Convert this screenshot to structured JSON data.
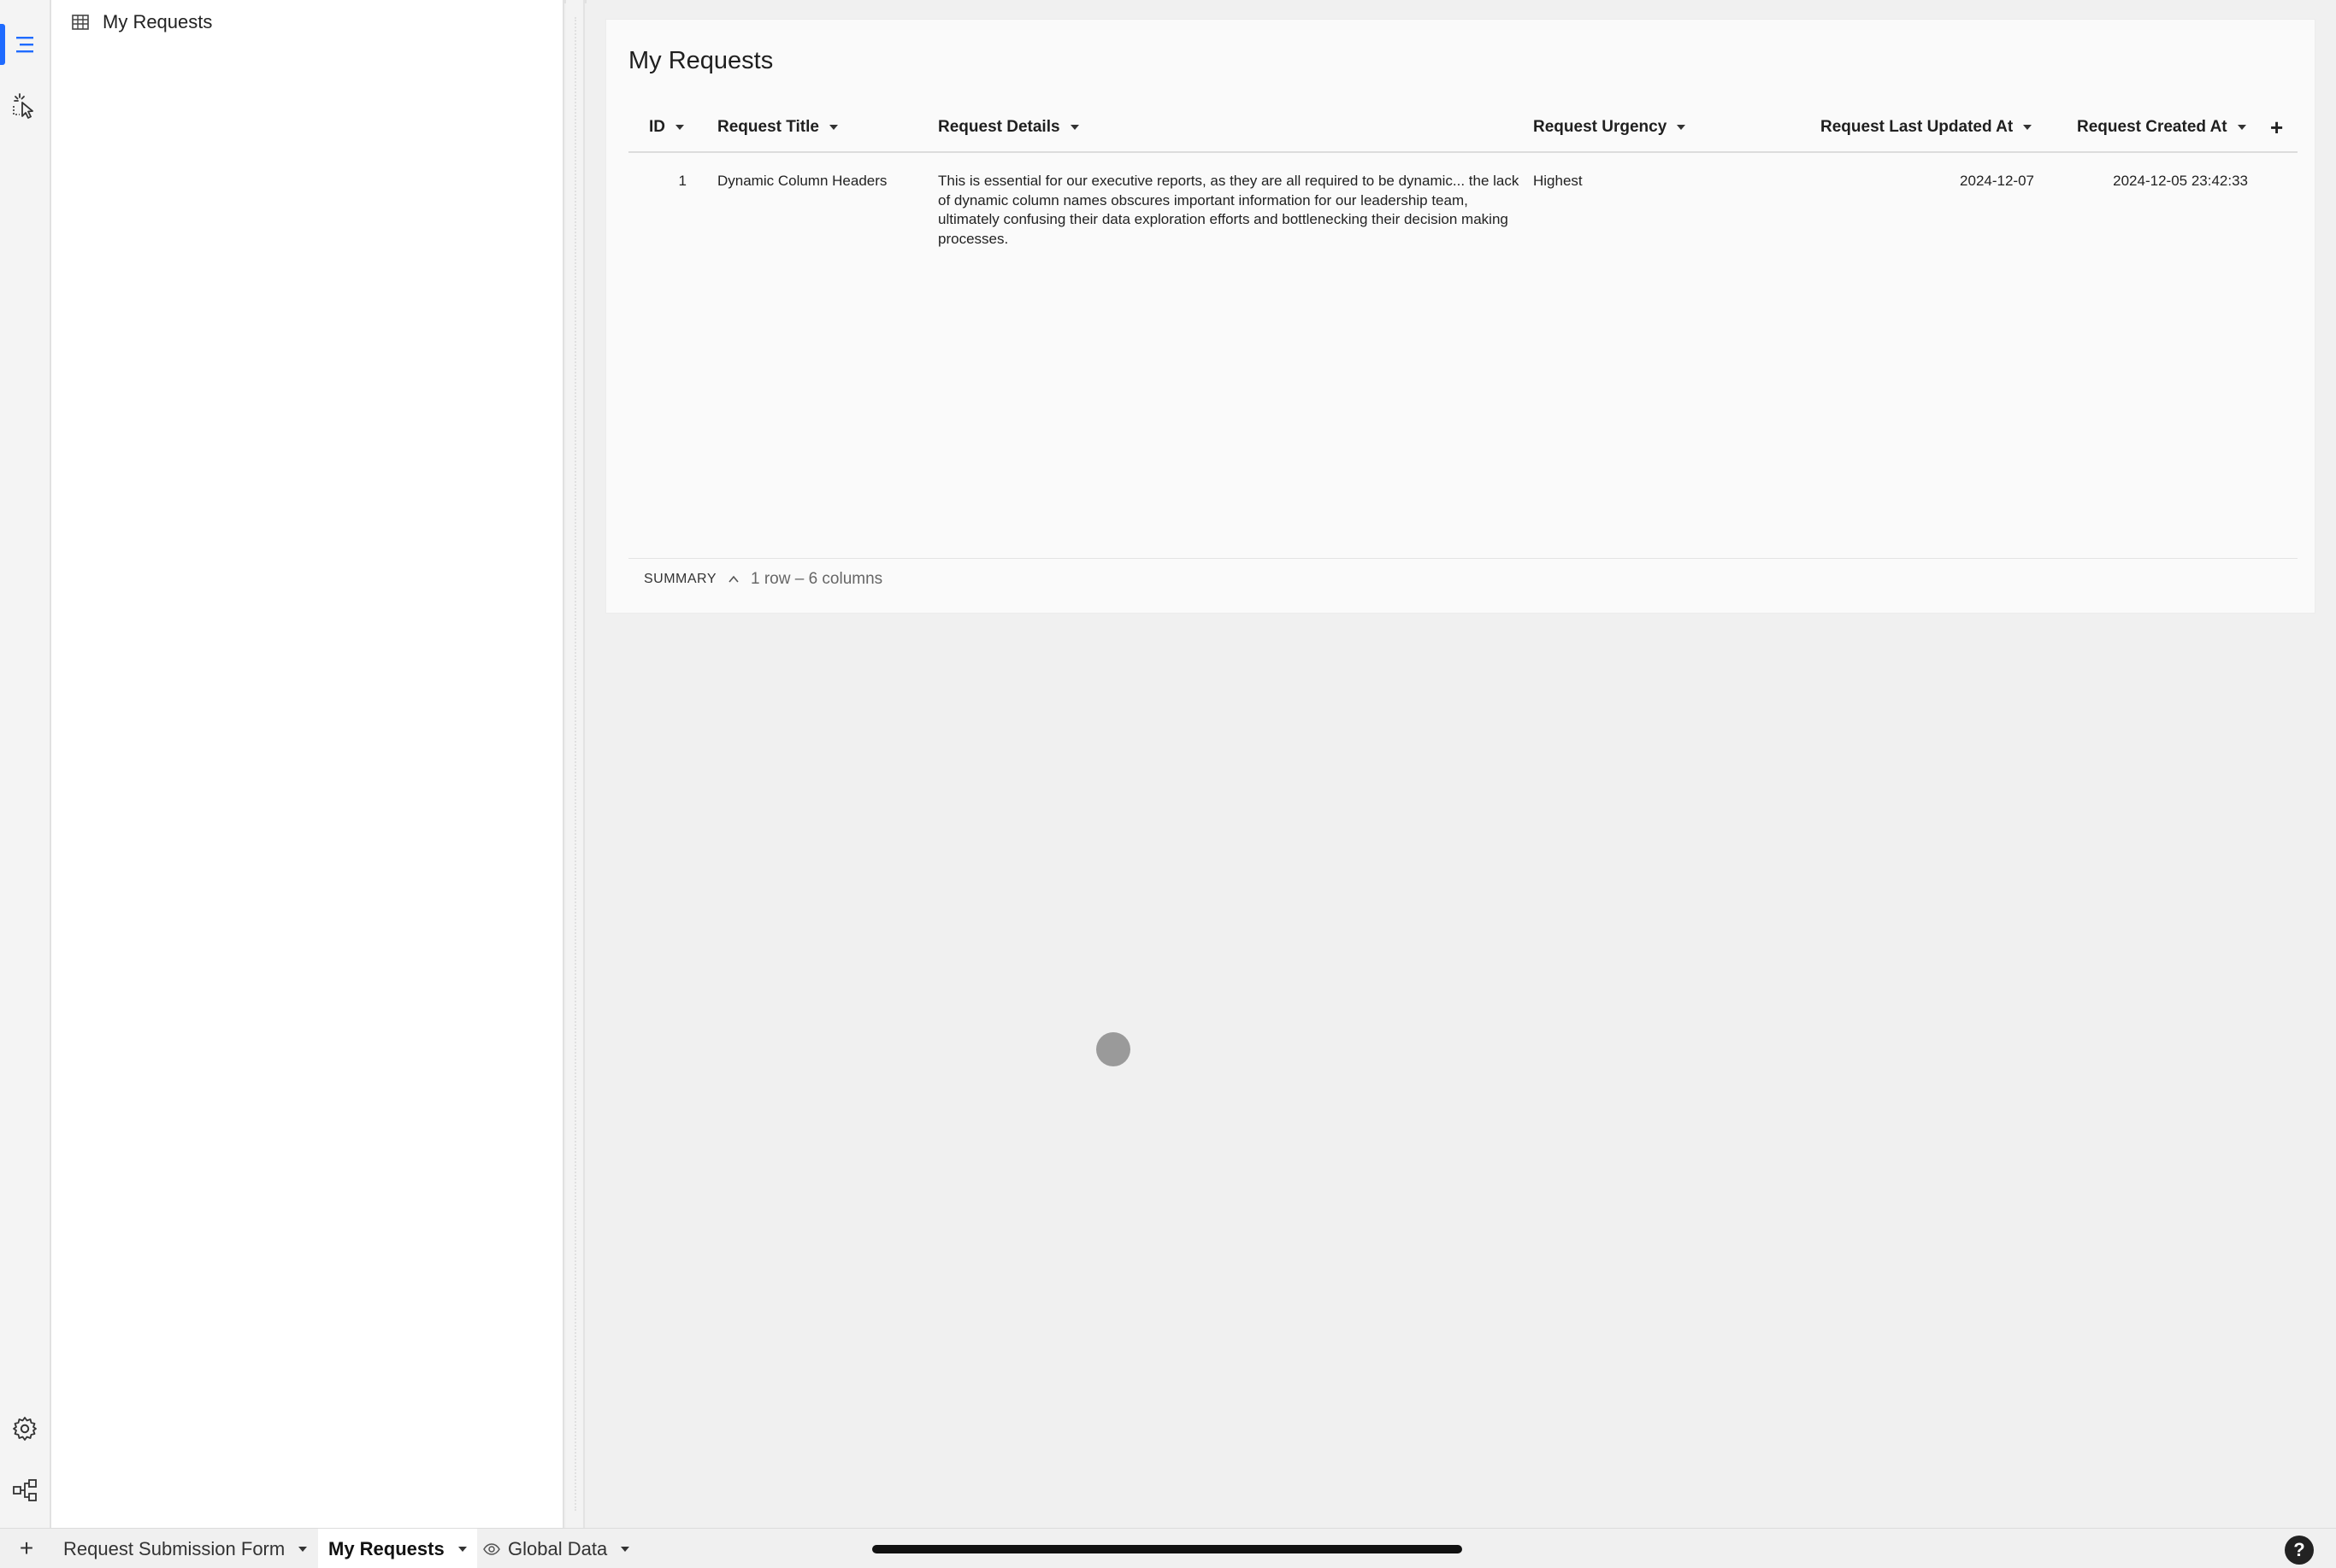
{
  "outline": {
    "items": [
      {
        "label": "My Requests",
        "icon": "table-icon"
      }
    ]
  },
  "rail": {
    "icons": [
      "outline-icon",
      "pointer-select-icon",
      "gear-icon",
      "data-lineage-icon"
    ],
    "accent": "#1f6bff"
  },
  "element": {
    "title": "My Requests",
    "columns": [
      {
        "label": "ID"
      },
      {
        "label": "Request Title"
      },
      {
        "label": "Request Details"
      },
      {
        "label": "Request Urgency"
      },
      {
        "label": "Request Last Updated At"
      },
      {
        "label": "Request Created At"
      }
    ],
    "add_column_label": "+",
    "rows": [
      {
        "id": "1",
        "title": "Dynamic Column Headers",
        "details": "This is essential for our executive reports, as they are all required to be dynamic... the lack of dynamic column names obscures important information for our leadership team, ultimately confusing their data exploration efforts and bottlenecking their decision making processes.",
        "urgency": "Highest",
        "last_updated": "2024-12-07",
        "created": "2024-12-05 23:42:33"
      }
    ],
    "summary": {
      "label": "SUMMARY",
      "count": "1 row – 6 columns"
    }
  },
  "tabs": {
    "add_label": "+",
    "pages": [
      {
        "label": "Request Submission Form",
        "active": false
      },
      {
        "label": "My Requests",
        "active": true
      },
      {
        "label": "Global Data",
        "active": false,
        "icon": "eye-icon"
      }
    ]
  },
  "help_label": "?"
}
